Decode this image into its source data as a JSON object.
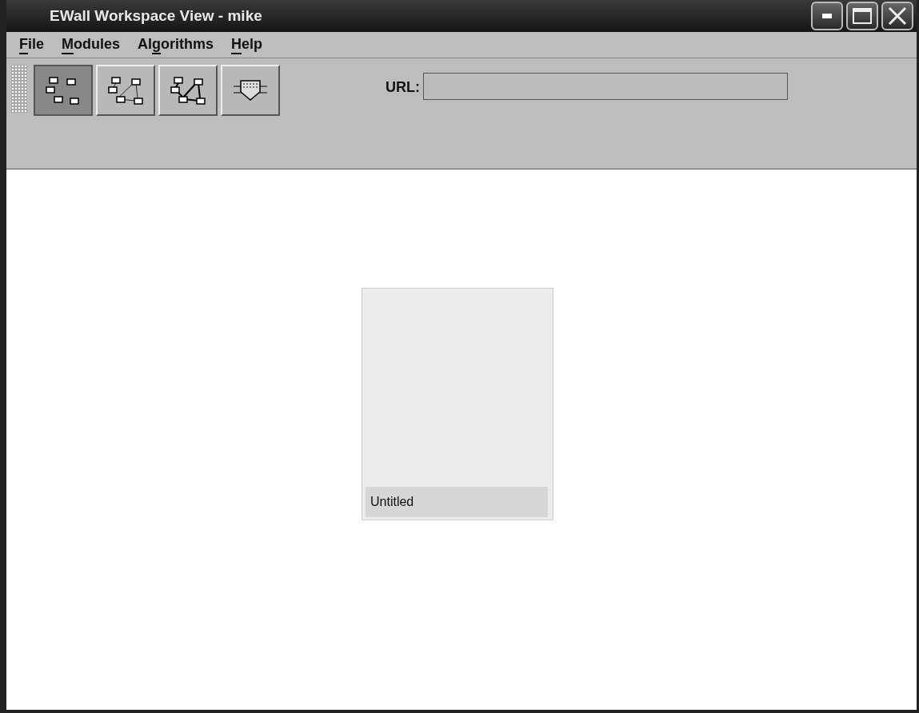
{
  "window": {
    "title": "EWall Workspace View - mike"
  },
  "menu": [
    {
      "parts": [
        {
          "text": "F",
          "underline": true
        },
        {
          "text": "ile",
          "underline": false
        }
      ]
    },
    {
      "parts": [
        {
          "text": "M",
          "underline": true
        },
        {
          "text": "odules",
          "underline": false
        }
      ]
    },
    {
      "parts": [
        {
          "text": "Al",
          "underline": false
        },
        {
          "text": "g",
          "underline": true
        },
        {
          "text": "orithms",
          "underline": false
        }
      ]
    },
    {
      "parts": [
        {
          "text": "H",
          "underline": true
        },
        {
          "text": "elp",
          "underline": false
        }
      ]
    }
  ],
  "toolbar": {
    "buttons": [
      {
        "kind": "scattered",
        "selected": true
      },
      {
        "kind": "linked",
        "selected": false
      },
      {
        "kind": "clustered",
        "selected": false
      },
      {
        "kind": "filter",
        "selected": false
      }
    ],
    "url": {
      "label": "URL:"
    }
  },
  "workspace": {
    "cards": [
      {
        "title": "Untitled"
      }
    ]
  }
}
